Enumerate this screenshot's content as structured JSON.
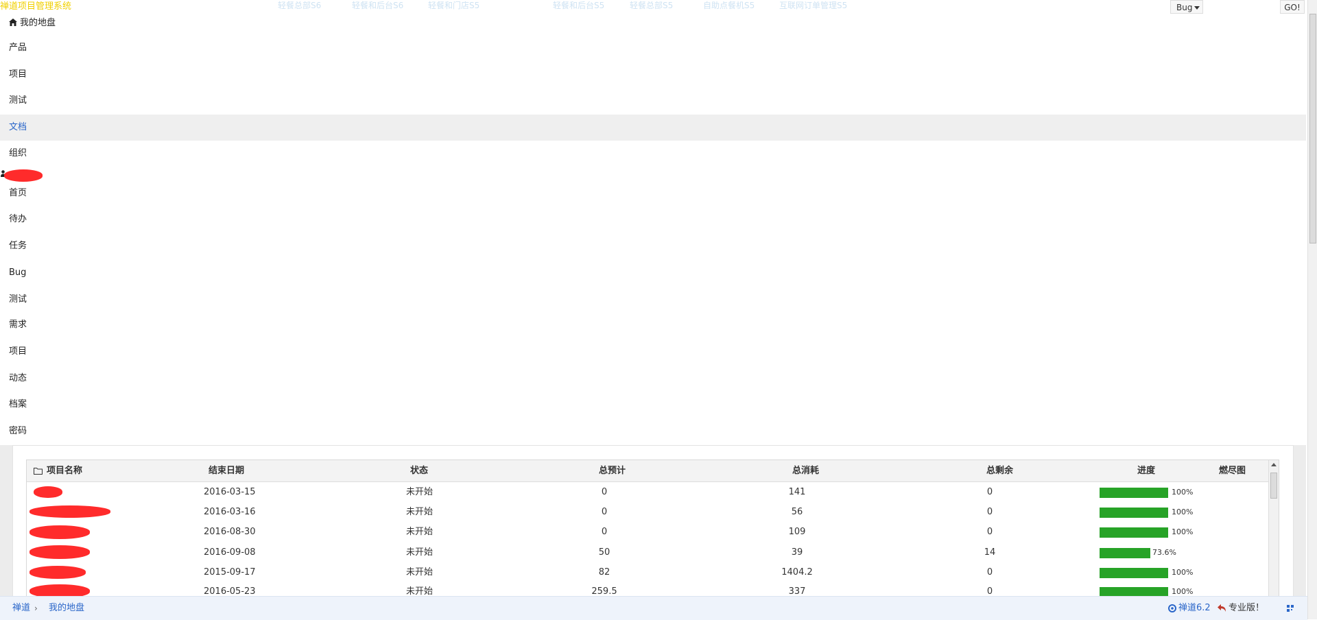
{
  "header": {
    "system_title": "禅道项目管理系统",
    "ghost_tabs": [
      "轻餐总部S6",
      "轻餐和后台S6",
      "轻餐和门店S5",
      "轻餐和后台S5",
      "轻餐总部S5",
      "自助点餐机S5",
      "互联网订单管理S5"
    ],
    "search_type": "Bug",
    "go_label": "GO!"
  },
  "nav": {
    "home": "我的地盘",
    "main_items": [
      "产品",
      "项目",
      "测试",
      "文档",
      "组织"
    ],
    "active_item": "文档",
    "sub_items": [
      "首页",
      "待办",
      "任务",
      "Bug",
      "测试",
      "需求",
      "项目",
      "动态",
      "档案",
      "密码"
    ]
  },
  "table": {
    "headers": [
      "项目名称",
      "结束日期",
      "状态",
      "总预计",
      "总消耗",
      "总剩余",
      "进度",
      "燃尽图"
    ],
    "rows": [
      {
        "end": "2016-03-15",
        "status": "未开始",
        "est": "0",
        "cons": "141",
        "left": "0",
        "pct": "100%",
        "p": 1.0
      },
      {
        "end": "2016-03-16",
        "status": "未开始",
        "est": "0",
        "cons": "56",
        "left": "0",
        "pct": "100%",
        "p": 1.0
      },
      {
        "end": "2016-08-30",
        "status": "未开始",
        "est": "0",
        "cons": "109",
        "left": "0",
        "pct": "100%",
        "p": 1.0
      },
      {
        "end": "2016-09-08",
        "status": "未开始",
        "est": "50",
        "cons": "39",
        "left": "14",
        "pct": "73.6%",
        "p": 0.736
      },
      {
        "end": "2015-09-17",
        "status": "未开始",
        "est": "82",
        "cons": "1404.2",
        "left": "0",
        "pct": "100%",
        "p": 1.0
      },
      {
        "end": "2016-05-23",
        "status": "未开始",
        "est": "259.5",
        "cons": "337",
        "left": "0",
        "pct": "100%",
        "p": 1.0
      }
    ]
  },
  "footer": {
    "crumb_root": "禅道",
    "crumb_current": "我的地盘",
    "version": "禅道6.2",
    "pro": "专业版！"
  },
  "colors": {
    "accent": "#2a66c9",
    "progress": "#27a327",
    "redaction": "#ff2b2b",
    "title": "#f0d000"
  }
}
